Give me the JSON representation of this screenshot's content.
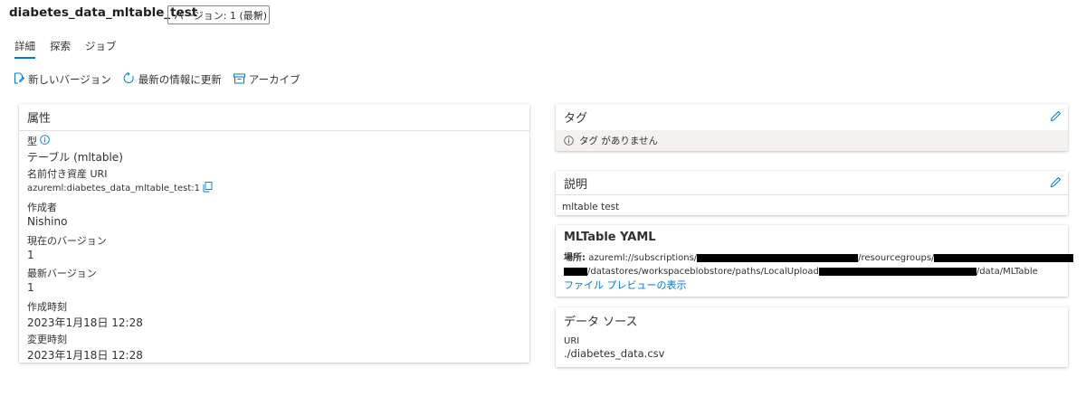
{
  "header": {
    "title": "diabetes_data_mltable_test",
    "version_label": "バージョン: 1 (最新)"
  },
  "tabs": [
    {
      "label": "詳細"
    },
    {
      "label": "探索"
    },
    {
      "label": "ジョブ"
    }
  ],
  "toolbar": {
    "new_version": "新しいバージョン",
    "refresh": "最新の情報に更新",
    "archive": "アーカイブ"
  },
  "properties": {
    "title": "属性",
    "type_label": "型",
    "type_value": "テーブル (mltable)",
    "uri_label": "名前付き資産 URI",
    "uri_value": "azureml:diabetes_data_mltable_test:1",
    "author_label": "作成者",
    "author_value": "Nishino",
    "current_version_label": "現在のバージョン",
    "current_version_value": "1",
    "latest_version_label": "最新バージョン",
    "latest_version_value": "1",
    "created_label": "作成時刻",
    "created_value": "2023年1月18日 12:28",
    "modified_label": "変更時刻",
    "modified_value": "2023年1月18日 12:28"
  },
  "tags": {
    "title": "タグ",
    "empty": "タグ がありません"
  },
  "description": {
    "title": "説明",
    "text": "mltable test"
  },
  "mltable": {
    "title": "MLTable YAML",
    "location_label": "場所:",
    "loc_part1": "azureml://subscriptions/",
    "loc_part2": "/resourcegroups/",
    "loc_part3": "/datastores/workspaceblobstore/paths/LocalUpload",
    "loc_part4": "/data/MLTable",
    "preview_link": "ファイル プレビューの表示"
  },
  "datasource": {
    "title": "データ ソース",
    "uri_label": "URI",
    "uri_value": "./diabetes_data.csv"
  },
  "colors": {
    "accent": "#0078d4",
    "text": "#323130"
  }
}
